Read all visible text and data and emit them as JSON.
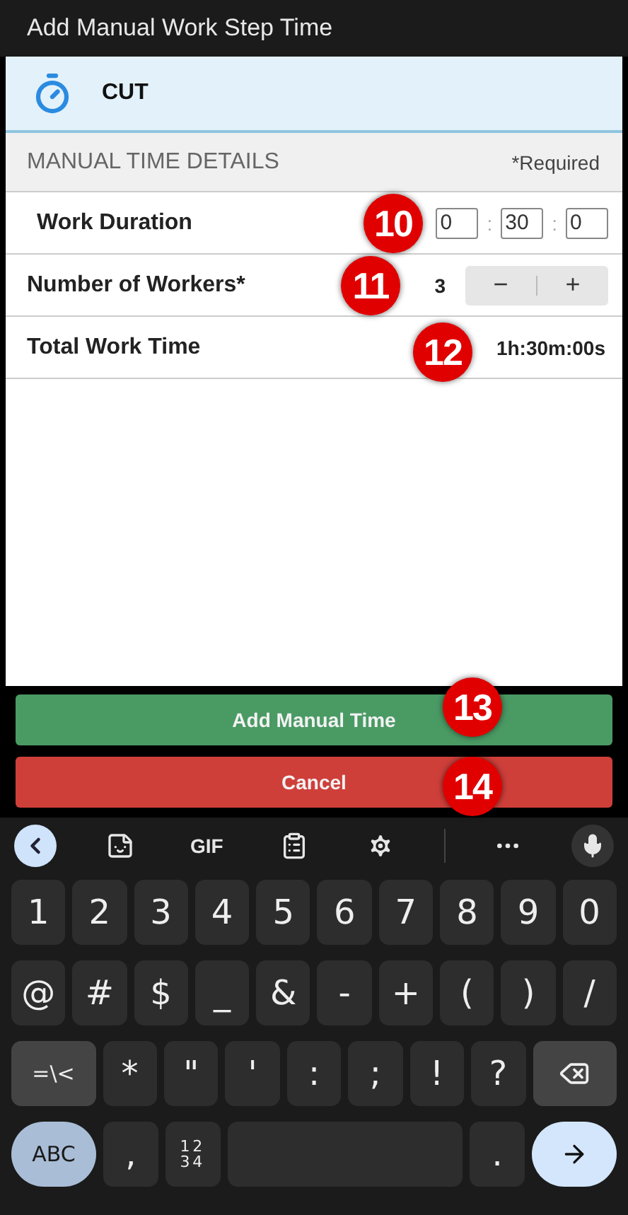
{
  "window": {
    "title": "Add Manual Work Step Time"
  },
  "step": {
    "name": "CUT"
  },
  "section": {
    "title": "MANUAL TIME DETAILS",
    "note": "*Required"
  },
  "rows": [
    {
      "kind": "duration",
      "label": "Work Duration",
      "fields": [
        "0",
        "30",
        "0"
      ],
      "separator": ":",
      "callout": "10"
    },
    {
      "kind": "stepper",
      "label": "Number of Workers*",
      "value": "3",
      "minus": "−",
      "plus": "+",
      "callout": "11"
    },
    {
      "kind": "total",
      "label": "Total Work Time",
      "value": "1h:30m:00s",
      "callout": "12"
    }
  ],
  "buttons": [
    {
      "kind": "primary",
      "label": "Add Manual Time",
      "callout": "13"
    },
    {
      "kind": "danger",
      "label": "Cancel",
      "callout": "14"
    }
  ],
  "keyboard": {
    "toolbar": [
      {
        "kind": "back"
      },
      {
        "kind": "sticker"
      },
      {
        "kind": "text",
        "label": "GIF"
      },
      {
        "kind": "clipboard"
      },
      {
        "kind": "settings"
      },
      {
        "kind": "divider"
      },
      {
        "kind": "more"
      },
      {
        "kind": "mic"
      }
    ],
    "rows": [
      [
        {
          "kind": "char",
          "label": "1"
        },
        {
          "kind": "char",
          "label": "2"
        },
        {
          "kind": "char",
          "label": "3"
        },
        {
          "kind": "char",
          "label": "4"
        },
        {
          "kind": "char",
          "label": "5"
        },
        {
          "kind": "char",
          "label": "6"
        },
        {
          "kind": "char",
          "label": "7"
        },
        {
          "kind": "char",
          "label": "8"
        },
        {
          "kind": "char",
          "label": "9"
        },
        {
          "kind": "char",
          "label": "0"
        }
      ],
      [
        {
          "kind": "char",
          "label": "@"
        },
        {
          "kind": "char",
          "label": "#"
        },
        {
          "kind": "char",
          "label": "$"
        },
        {
          "kind": "char",
          "label": "_"
        },
        {
          "kind": "char",
          "label": "&"
        },
        {
          "kind": "char",
          "label": "-"
        },
        {
          "kind": "char",
          "label": "+"
        },
        {
          "kind": "char",
          "label": "("
        },
        {
          "kind": "char",
          "label": ")"
        },
        {
          "kind": "char",
          "label": "/"
        }
      ],
      [
        {
          "kind": "wide",
          "label": "=\\<"
        },
        {
          "kind": "char",
          "label": "*"
        },
        {
          "kind": "char",
          "label": "\""
        },
        {
          "kind": "char",
          "label": "'"
        },
        {
          "kind": "char",
          "label": ":"
        },
        {
          "kind": "char",
          "label": ";"
        },
        {
          "kind": "char",
          "label": "!"
        },
        {
          "kind": "char",
          "label": "?"
        },
        {
          "kind": "backspace"
        }
      ],
      [
        {
          "kind": "pill",
          "label": "ABC"
        },
        {
          "kind": "char",
          "label": ","
        },
        {
          "kind": "stack",
          "lines": [
            "12",
            "34"
          ]
        },
        {
          "kind": "space"
        },
        {
          "kind": "char",
          "label": "."
        },
        {
          "kind": "enter"
        }
      ]
    ]
  }
}
